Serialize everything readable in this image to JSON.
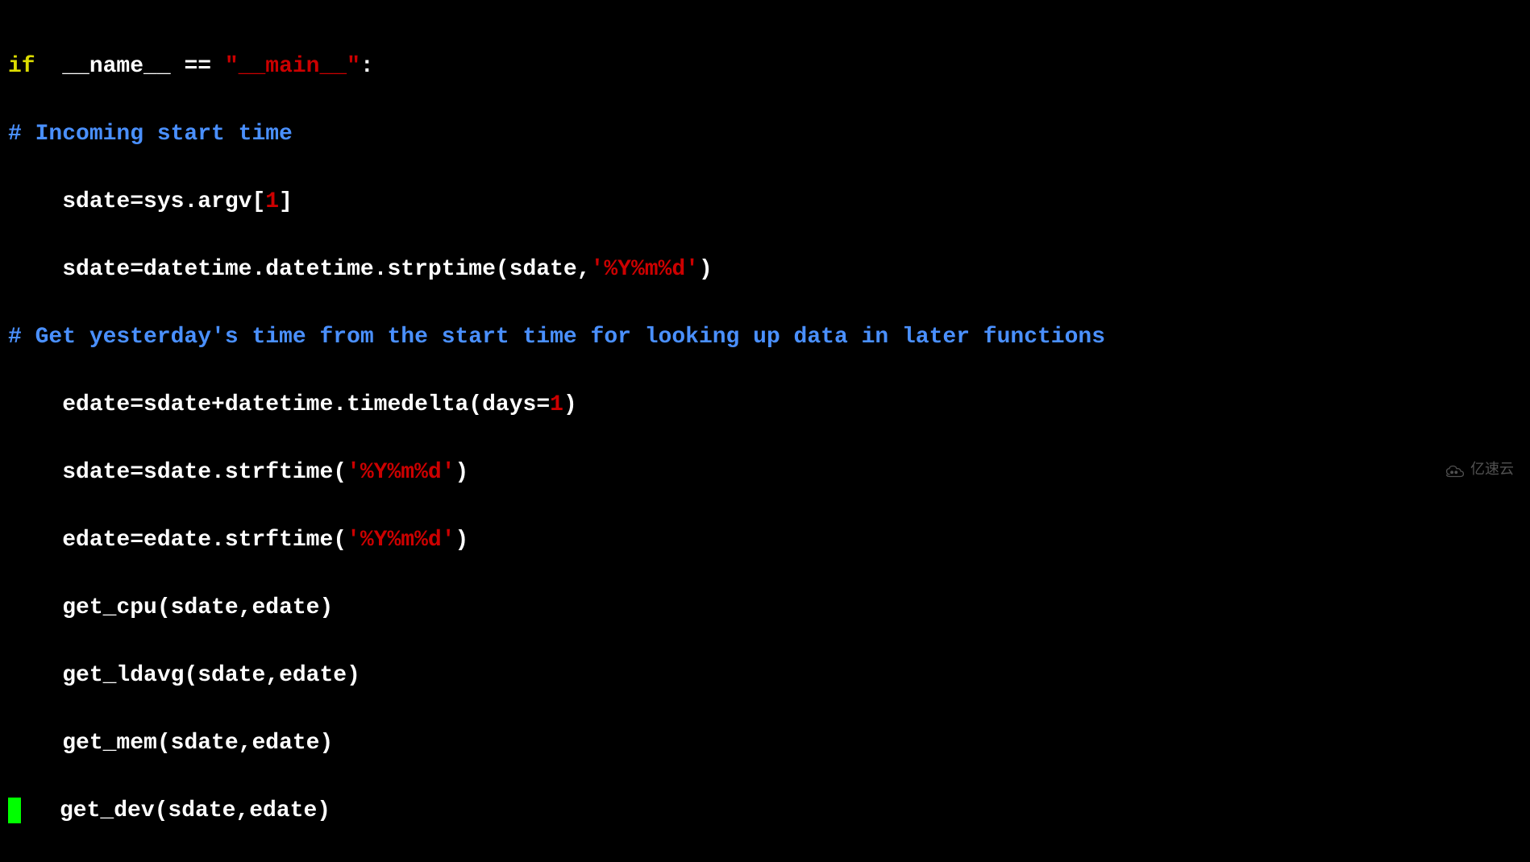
{
  "code": {
    "line1": {
      "if": "if",
      "name": "  __name__ == ",
      "main_str": "\"__main__\"",
      "colon": ":"
    },
    "line2": {
      "comment": "# Incoming start time"
    },
    "line3": {
      "indent": "    ",
      "pre": "sdate=sys.argv[",
      "num": "1",
      "post": "]"
    },
    "line4": {
      "indent": "    ",
      "pre": "sdate=datetime.datetime.strptime(sdate,",
      "str": "'%Y%m%d'",
      "post": ")"
    },
    "line5": {
      "comment": "# Get yesterday's time from the start time for looking up data in later functions"
    },
    "line6": {
      "indent": "    ",
      "pre": "edate=sdate+datetime.timedelta(days=",
      "num": "1",
      "post": ")"
    },
    "line7": {
      "indent": "    ",
      "pre": "sdate=sdate.strftime(",
      "str": "'%Y%m%d'",
      "post": ")"
    },
    "line8": {
      "indent": "    ",
      "pre": "edate=edate.strftime(",
      "str": "'%Y%m%d'",
      "post": ")"
    },
    "line9": {
      "indent": "    ",
      "text": "get_cpu(sdate,edate)"
    },
    "line10": {
      "indent": "    ",
      "text": "get_ldavg(sdate,edate)"
    },
    "line11": {
      "indent": "    ",
      "text": "get_mem(sdate,edate)"
    },
    "line12": {
      "text": "get_dev(sdate,edate)"
    }
  },
  "watermark": {
    "text": "亿速云"
  }
}
